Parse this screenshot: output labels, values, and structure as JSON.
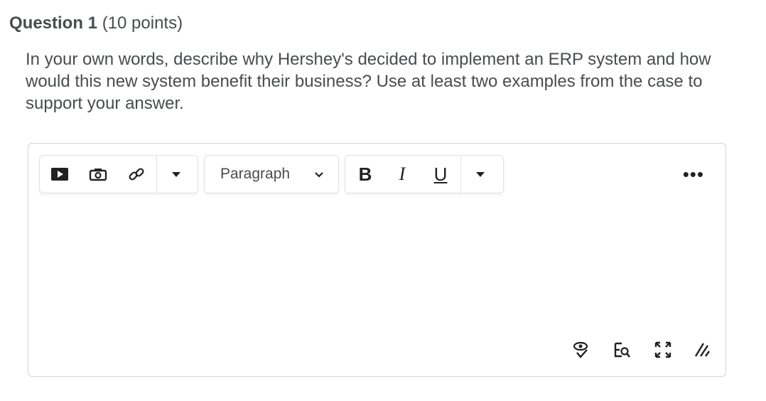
{
  "question": {
    "label": "Question 1",
    "points": "(10 points)",
    "prompt": "In your own words, describe why Hershey's decided to implement an ERP system and how would this new system benefit their business?  Use at least two examples from the case to support your answer."
  },
  "toolbar": {
    "insert_stuff_icon": "video-play-icon",
    "insert_image_icon": "camera-icon",
    "insert_link_icon": "link-icon",
    "insert_more_icon": "chevron-down-icon",
    "format_select": "Paragraph",
    "bold_label": "B",
    "italic_label": "I",
    "underline_label": "U",
    "more_actions": "•••"
  },
  "status_bar": {
    "icons": [
      "accessibility-check-icon",
      "word-count-icon",
      "fullscreen-icon",
      "resize-handle-icon"
    ]
  }
}
